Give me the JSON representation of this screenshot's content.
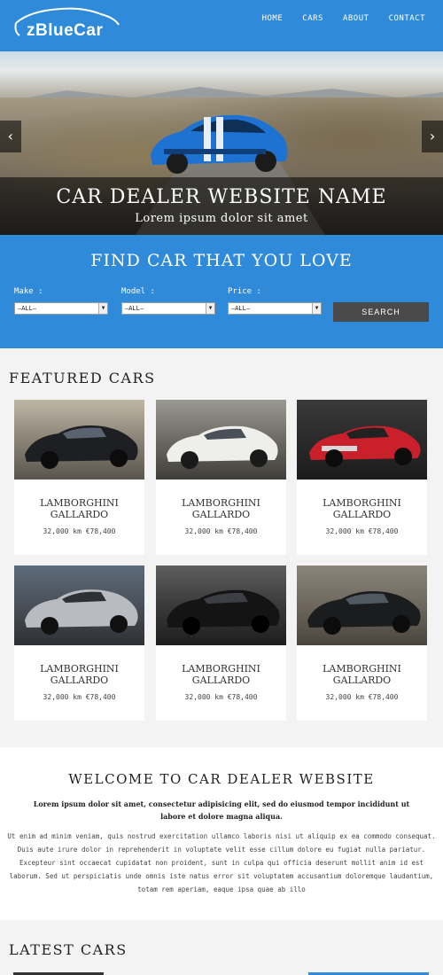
{
  "header": {
    "logo_text": "zBlueCar",
    "nav": [
      "HOME",
      "CARS",
      "ABOUT",
      "CONTACT"
    ]
  },
  "hero": {
    "title": "CAR DEALER WEBSITE NAME",
    "subtitle": "Lorem ipsum dolor sit amet",
    "prev": "‹",
    "next": "›"
  },
  "finder": {
    "title": "FIND CAR THAT YOU LOVE",
    "make_label": "Make :",
    "model_label": "Model :",
    "price_label": "Price :",
    "make_value": "—ALL—",
    "model_value": "—ALL—",
    "price_value": "—ALL—",
    "search_label": "SEARCH"
  },
  "featured": {
    "title": "FEATURED CARS",
    "cars": [
      {
        "name_line1": "LAMBORGHINI",
        "name_line2": "GALLARDO",
        "meta": "32,000 km €78,400"
      },
      {
        "name_line1": "LAMBORGHINI",
        "name_line2": "GALLARDO",
        "meta": "32,000 km €78,400"
      },
      {
        "name_line1": "LAMBORGHINI",
        "name_line2": "GALLARDO",
        "meta": "32,000 km €78,400"
      },
      {
        "name_line1": "LAMBORGHINI",
        "name_line2": "GALLARDO",
        "meta": "32,000 km €78,400"
      },
      {
        "name_line1": "LAMBORGHINI",
        "name_line2": "GALLARDO",
        "meta": "32,000 km €78,400"
      },
      {
        "name_line1": "LAMBORGHINI",
        "name_line2": "GALLARDO",
        "meta": "32,000 km €78,400"
      }
    ]
  },
  "welcome": {
    "title": "WELCOME TO CAR DEALER WEBSITE",
    "lead": "Lorem ipsum dolor sit amet, consectetur adipisicing elit, sed do eiusmod tempor incididunt ut labore et dolore magna aliqua.",
    "body": "Ut enim ad minim veniam, quis nostrud exercitation ullamco laboris nisi ut aliquip ex ea commodo consequat. Duis aute irure dolor in reprehenderit in voluptate velit esse cillum dolore eu fugiat nulla pariatur. Excepteur sint occaecat cupidatat non proident, sunt in culpa qui officia deserunt mollit anim id est laborum. Sed ut perspiciatis unde omnis iste natus error sit voluptatem accusantium doloremque laudantium, totam rem aperiam, eaque ipsa quae ab illo"
  },
  "latest": {
    "title": "LATEST CARS"
  },
  "colors": {
    "brand_blue": "#2f8bd9",
    "search_button": "#4a4a4a"
  }
}
